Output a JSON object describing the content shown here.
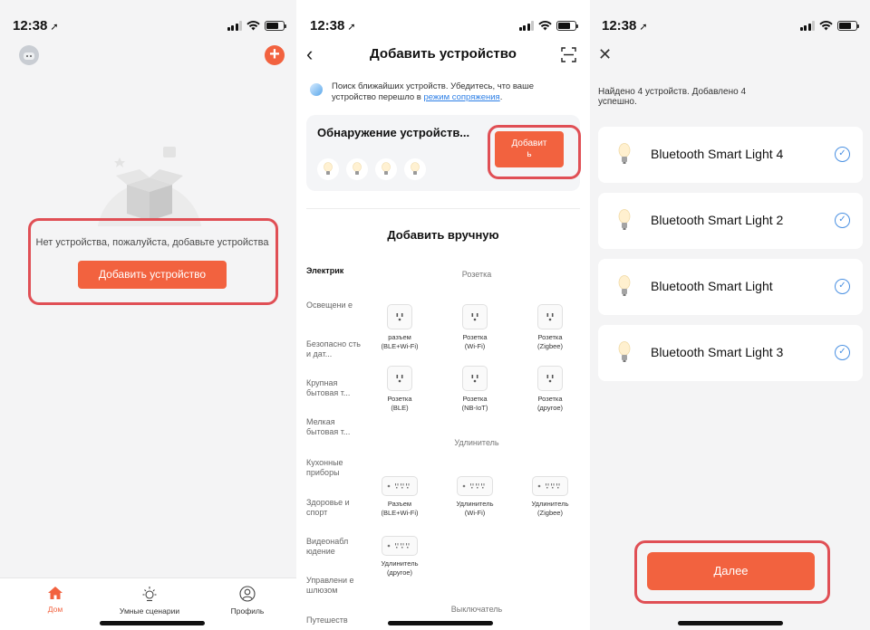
{
  "status_bar": {
    "time": "12:38",
    "location_arrow": "location-arrow-icon"
  },
  "screen1": {
    "empty_text": "Нет устройства, пожалуйста, добавьте устройства",
    "add_device_button": "Добавить устройство",
    "tabs": [
      {
        "label": "Дом",
        "icon": "home-icon",
        "active": true
      },
      {
        "label": "Умные сценарии",
        "icon": "sun-icon",
        "active": false
      },
      {
        "label": "Профиль",
        "icon": "profile-icon",
        "active": false
      }
    ],
    "accent_color": "#f2623f",
    "highlight_color": "#e04f55"
  },
  "screen2": {
    "title": "Добавить устройство",
    "search_text": "Поиск ближайших устройств. Убедитесь, что ваше устройство перешло в",
    "search_link": "режим сопряжения",
    "search_end": ".",
    "discover_title": "Обнаружение устройств...",
    "discover_button_line1": "Добавит",
    "discover_button_line2": "ь",
    "manual_title": "Добавить вручную",
    "categories": [
      "Электрик",
      "Освещени е",
      "Безопасно сть и дат...",
      "Крупная бытовая т...",
      "Мелкая бытовая т...",
      "Кухонные приборы",
      "Здоровье и спорт",
      "Видеонабл юдение",
      "Управлени е шлюзом",
      "Путешеств"
    ],
    "section_socket": "Розетка",
    "section_extender": "Удлинитель",
    "section_switch": "Выключатель",
    "sockets": [
      {
        "l1": "разъем",
        "l2": "(BLE+Wi-Fi)"
      },
      {
        "l1": "Розетка",
        "l2": "(Wi-Fi)"
      },
      {
        "l1": "Розетка",
        "l2": "(Zigbee)"
      },
      {
        "l1": "Розетка",
        "l2": "(BLE)"
      },
      {
        "l1": "Розетка",
        "l2": "(NB-IoT)"
      },
      {
        "l1": "Розетка",
        "l2": "(другое)"
      }
    ],
    "extenders": [
      {
        "l1": "Разъем",
        "l2": "(BLE+Wi-Fi)"
      },
      {
        "l1": "Удлинитель",
        "l2": "(Wi-Fi)"
      },
      {
        "l1": "Удлинитель",
        "l2": "(Zigbee)"
      },
      {
        "l1": "Удлинитель",
        "l2": "(другое)"
      }
    ]
  },
  "screen3": {
    "found_text": "Найдено 4 устройств. Добавлено 4 успешно.",
    "devices": [
      "Bluetooth Smart Light 4",
      "Bluetooth Smart Light 2",
      "Bluetooth Smart Light",
      "Bluetooth Smart Light 3"
    ],
    "next_button": "Далее",
    "check_color": "#4a90e2"
  }
}
